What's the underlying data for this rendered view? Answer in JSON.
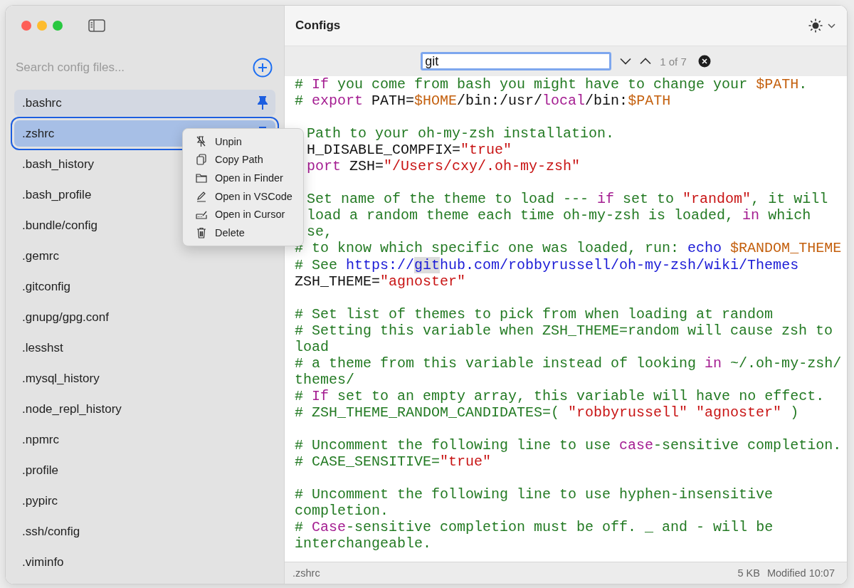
{
  "sidebar": {
    "search": {
      "placeholder": "Search config files..."
    },
    "files": [
      {
        "name": ".bashrc",
        "pinned": true,
        "selected": false
      },
      {
        "name": ".zshrc",
        "pinned": true,
        "selected": true
      },
      {
        "name": ".bash_history",
        "pinned": false,
        "selected": false
      },
      {
        "name": ".bash_profile",
        "pinned": false,
        "selected": false
      },
      {
        "name": ".bundle/config",
        "pinned": false,
        "selected": false
      },
      {
        "name": ".gemrc",
        "pinned": false,
        "selected": false
      },
      {
        "name": ".gitconfig",
        "pinned": false,
        "selected": false
      },
      {
        "name": ".gnupg/gpg.conf",
        "pinned": false,
        "selected": false
      },
      {
        "name": ".lesshst",
        "pinned": false,
        "selected": false
      },
      {
        "name": ".mysql_history",
        "pinned": false,
        "selected": false
      },
      {
        "name": ".node_repl_history",
        "pinned": false,
        "selected": false
      },
      {
        "name": ".npmrc",
        "pinned": false,
        "selected": false
      },
      {
        "name": ".profile",
        "pinned": false,
        "selected": false
      },
      {
        "name": ".pypirc",
        "pinned": false,
        "selected": false
      },
      {
        "name": ".ssh/config",
        "pinned": false,
        "selected": false
      },
      {
        "name": ".viminfo",
        "pinned": false,
        "selected": false
      }
    ]
  },
  "context_menu": [
    {
      "label": "Unpin",
      "kind": "unpin"
    },
    {
      "label": "Copy Path",
      "kind": "copy"
    },
    {
      "label": "Open in Finder",
      "kind": "folder"
    },
    {
      "label": "Open in VSCode",
      "kind": "pencil"
    },
    {
      "label": "Open in Cursor",
      "kind": "cursor"
    },
    {
      "label": "Delete",
      "kind": "trash"
    }
  ],
  "header": {
    "title": "Configs"
  },
  "find_bar": {
    "value": "git",
    "count": "1 of 7"
  },
  "editor": {
    "lines": [
      {
        "kind": "code",
        "segments": [
          {
            "kind": "comment",
            "text": "# "
          },
          {
            "kind": "keyword",
            "text": "If"
          },
          {
            "kind": "comment",
            "text": " you come from bash you might have to change your "
          },
          {
            "kind": "variable",
            "text": "$PATH"
          },
          {
            "kind": "comment",
            "text": "."
          }
        ]
      },
      {
        "kind": "code",
        "segments": [
          {
            "kind": "comment",
            "text": "# "
          },
          {
            "kind": "keyword",
            "text": "export"
          },
          {
            "kind": "plain",
            "text": " PATH="
          },
          {
            "kind": "variable",
            "text": "$HOME"
          },
          {
            "kind": "plain",
            "text": "/bin:/usr/"
          },
          {
            "kind": "keyword",
            "text": "local"
          },
          {
            "kind": "plain",
            "text": "/bin:"
          },
          {
            "kind": "variable",
            "text": "$PATH"
          }
        ]
      },
      {
        "kind": "blank"
      },
      {
        "kind": "covered",
        "segments": [
          {
            "kind": "comment",
            "text": "Path to your oh-my-zsh installation."
          }
        ]
      },
      {
        "kind": "covered",
        "segments": [
          {
            "kind": "plain",
            "text": "H_DISABLE_COMPFIX="
          },
          {
            "kind": "string",
            "text": "\"true\""
          }
        ]
      },
      {
        "kind": "covered",
        "segments": [
          {
            "kind": "keyword",
            "text": "port"
          },
          {
            "kind": "plain",
            "text": " ZSH="
          },
          {
            "kind": "string",
            "text": "\"/Users/cxy/.oh-my-zsh\""
          }
        ]
      },
      {
        "kind": "blank"
      },
      {
        "kind": "covered",
        "segments": [
          {
            "kind": "comment",
            "text": "Set name of the theme to load --- "
          },
          {
            "kind": "keyword",
            "text": "if"
          },
          {
            "kind": "comment",
            "text": " set to "
          },
          {
            "kind": "string",
            "text": "\"random\""
          },
          {
            "kind": "comment",
            "text": ", it will"
          }
        ]
      },
      {
        "kind": "covered",
        "segments": [
          {
            "kind": "comment",
            "text": "load a random theme each time oh-my-zsh is loaded, "
          },
          {
            "kind": "keyword",
            "text": "in"
          },
          {
            "kind": "comment",
            "text": " which"
          }
        ]
      },
      {
        "kind": "covered",
        "segments": [
          {
            "kind": "comment",
            "text": "se,"
          }
        ]
      },
      {
        "kind": "code",
        "segments": [
          {
            "kind": "comment",
            "text": "# to know which specific one was loaded, run: "
          },
          {
            "kind": "builtin",
            "text": "echo"
          },
          {
            "kind": "variable",
            "text": " $RANDOM_THEME"
          }
        ]
      },
      {
        "kind": "code",
        "segments": [
          {
            "kind": "comment",
            "text": "# See "
          },
          {
            "kind": "link",
            "text": "https://"
          },
          {
            "kind": "match",
            "text": "git"
          },
          {
            "kind": "link",
            "text": "hub.com/robbyrussell/oh-my-zsh/wiki/Themes"
          }
        ]
      },
      {
        "kind": "code",
        "segments": [
          {
            "kind": "plain",
            "text": "ZSH_THEME="
          },
          {
            "kind": "string",
            "text": "\"agnoster\""
          }
        ]
      },
      {
        "kind": "blank"
      },
      {
        "kind": "code",
        "segments": [
          {
            "kind": "comment",
            "text": "# Set list of themes to pick from when loading at random"
          }
        ]
      },
      {
        "kind": "code",
        "segments": [
          {
            "kind": "comment",
            "text": "# Setting this variable when ZSH_THEME=random will cause zsh to"
          }
        ]
      },
      {
        "kind": "code",
        "segments": [
          {
            "kind": "comment",
            "text": "load"
          }
        ]
      },
      {
        "kind": "code",
        "segments": [
          {
            "kind": "comment",
            "text": "# a theme from this variable instead of looking "
          },
          {
            "kind": "keyword",
            "text": "in"
          },
          {
            "kind": "comment",
            "text": " ~/.oh-my-zsh/"
          }
        ]
      },
      {
        "kind": "code",
        "segments": [
          {
            "kind": "comment",
            "text": "themes/"
          }
        ]
      },
      {
        "kind": "code",
        "segments": [
          {
            "kind": "comment",
            "text": "# "
          },
          {
            "kind": "keyword",
            "text": "If"
          },
          {
            "kind": "comment",
            "text": " set to an empty array, this variable will have no effect."
          }
        ]
      },
      {
        "kind": "code",
        "segments": [
          {
            "kind": "comment",
            "text": "# ZSH_THEME_RANDOM_CANDIDATES=( "
          },
          {
            "kind": "string",
            "text": "\"robbyrussell\""
          },
          {
            "kind": "string",
            "text": " \"agnoster\""
          },
          {
            "kind": "comment",
            "text": " )"
          }
        ]
      },
      {
        "kind": "blank"
      },
      {
        "kind": "code",
        "segments": [
          {
            "kind": "comment",
            "text": "# Uncomment the following line to use "
          },
          {
            "kind": "keyword",
            "text": "case"
          },
          {
            "kind": "comment",
            "text": "-sensitive completion."
          }
        ]
      },
      {
        "kind": "code",
        "segments": [
          {
            "kind": "comment",
            "text": "# CASE_SENSITIVE="
          },
          {
            "kind": "string",
            "text": "\"true\""
          }
        ]
      },
      {
        "kind": "blank"
      },
      {
        "kind": "code",
        "segments": [
          {
            "kind": "comment",
            "text": "# Uncomment the following line to use hyphen-insensitive"
          }
        ]
      },
      {
        "kind": "code",
        "segments": [
          {
            "kind": "comment",
            "text": "completion."
          }
        ]
      },
      {
        "kind": "code",
        "segments": [
          {
            "kind": "comment",
            "text": "# "
          },
          {
            "kind": "keyword",
            "text": "Case"
          },
          {
            "kind": "comment",
            "text": "-sensitive completion must be off. _ and - will be"
          }
        ]
      },
      {
        "kind": "code",
        "segments": [
          {
            "kind": "comment",
            "text": "interchangeable."
          }
        ]
      }
    ]
  },
  "status_bar": {
    "file": ".zshrc",
    "size": "5 KB",
    "modified": "Modified 10:07"
  }
}
